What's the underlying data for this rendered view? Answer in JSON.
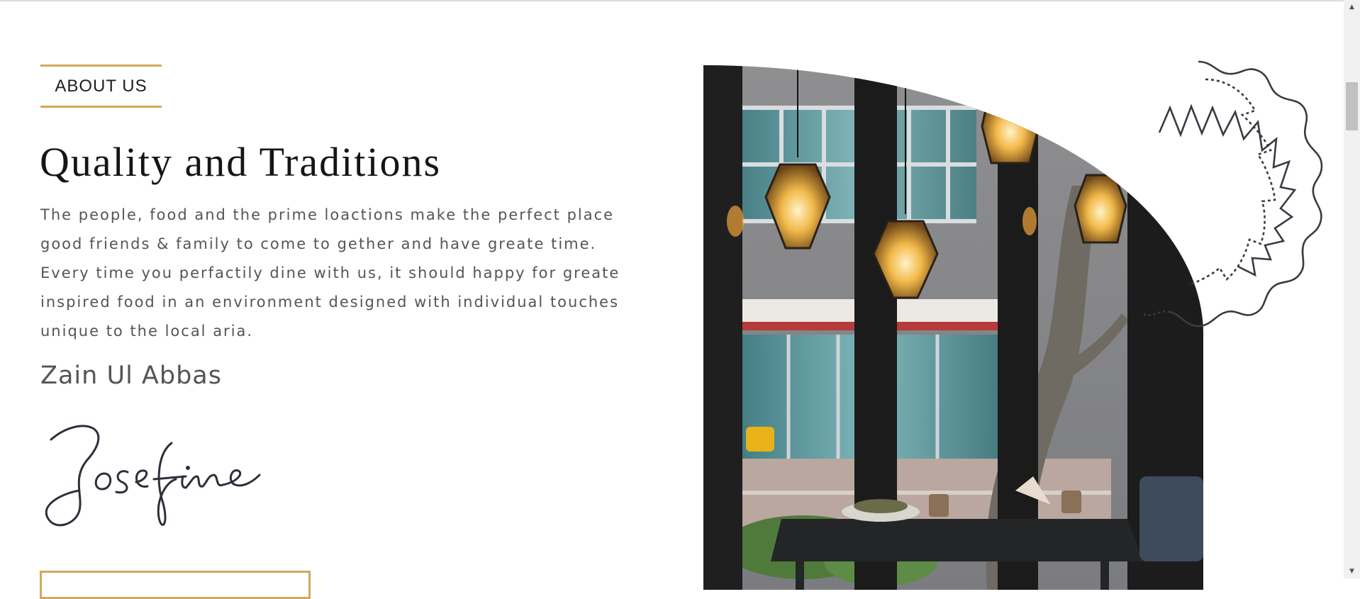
{
  "about": {
    "tag_label": "ABOUT US",
    "heading": "Quality and Traditions",
    "intro_lines": [
      "The people, food and the prime loactions make the perfect place",
      "good friends & family to come to gether and have greate time.",
      "Every time you perfactily dine with us, it should happy for greate",
      "inspired food in an environment designed with individual touches",
      "unique to the local aria."
    ],
    "person_name": "Zain Ul Abbas",
    "signature_text": "Josefine",
    "cta_label": ""
  },
  "icons": {
    "decor": "flower-outline-icon",
    "scroll_up": "chevron-up-icon",
    "scroll_down": "chevron-down-icon"
  },
  "colors": {
    "accent": "#d4a85a",
    "heading": "#151515",
    "body_text": "#555555",
    "decor_stroke": "#3a3a44"
  }
}
